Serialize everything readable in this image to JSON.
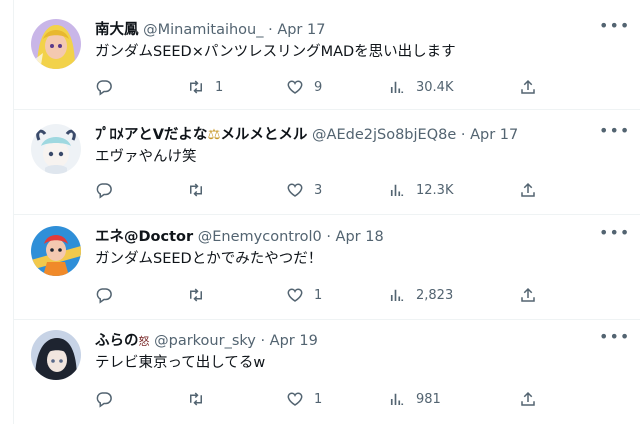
{
  "tweets": [
    {
      "name": "南大鳳",
      "handle": "@Minamitaihou_",
      "sep": "·",
      "date": "Apr 17",
      "text": "ガンダムSEED×パンツレスリングMADを思い出します",
      "replies": "",
      "retweets": "1",
      "likes": "9",
      "views": "30.4K",
      "avatar_colors": [
        "#c9b6e8",
        "#f2d24a",
        "#f4c9b0"
      ]
    },
    {
      "name": "ﾌﾟﾛﾒアとVだよな",
      "name_emoji": "⚖",
      "name_suffix": "メルメとメル",
      "handle": "@AEde2jSo8bjEQ8e",
      "sep": "·",
      "date": "Apr 17",
      "text": "エヴァやんけ笑",
      "replies": "",
      "retweets": "",
      "likes": "3",
      "views": "12.3K",
      "avatar_colors": [
        "#dfe6ee",
        "#9fd8e0",
        "#3a4a6a"
      ]
    },
    {
      "name": "エネ@Doctor",
      "handle": "@Enemycontrol0",
      "sep": "·",
      "date": "Apr 18",
      "text": "ガンダムSEEDとかでみたやつだ！",
      "replies": "",
      "retweets": "",
      "likes": "1",
      "views": "2,823",
      "avatar_colors": [
        "#2f8fd8",
        "#f08a2a",
        "#e23a3a"
      ]
    },
    {
      "name": "ふらの",
      "name_emoji": "怒",
      "handle": "@parkour_sky",
      "sep": "·",
      "date": "Apr 19",
      "text": "テレビ東京って出してるw",
      "replies": "",
      "retweets": "",
      "likes": "1",
      "views": "981",
      "avatar_colors": [
        "#1e2430",
        "#5a6a8a",
        "#c7d3e6"
      ]
    }
  ],
  "icons": {
    "reply": "reply-icon",
    "retweet": "retweet-icon",
    "like": "heart-icon",
    "views": "views-icon",
    "share": "share-icon",
    "more": "more-icon"
  },
  "colors": {
    "text": "#0f1419",
    "muted": "#536471",
    "border": "#eff3f4"
  }
}
